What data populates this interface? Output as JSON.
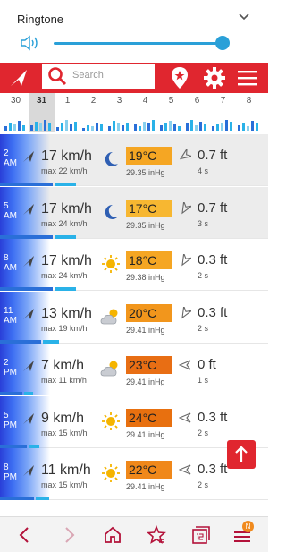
{
  "volume_panel": {
    "title": "Ringtone",
    "level": 0.97
  },
  "toolbar": {
    "search_placeholder": "Search"
  },
  "days": [
    {
      "num": "30",
      "selected": false
    },
    {
      "num": "31",
      "selected": true
    },
    {
      "num": "1",
      "selected": false
    },
    {
      "num": "2",
      "selected": false
    },
    {
      "num": "3",
      "selected": false
    },
    {
      "num": "4",
      "selected": false
    },
    {
      "num": "5",
      "selected": false
    },
    {
      "num": "6",
      "selected": false
    },
    {
      "num": "7",
      "selected": false
    },
    {
      "num": "8",
      "selected": false
    }
  ],
  "rows": [
    {
      "hour": "2",
      "ampm": "AM",
      "wind": "17 km/h",
      "max": "max 22 km/h",
      "weather": "moon",
      "temp": "19°C",
      "temp_color": "#f5a623",
      "pressure": "29.35 inHg",
      "swell": "0.7 ft",
      "period": "4 s",
      "wind_level": 0.31
    },
    {
      "hour": "5",
      "ampm": "AM",
      "wind": "17 km/h",
      "max": "max 24 km/h",
      "weather": "moon",
      "temp": "17°C",
      "temp_color": "#f7b731",
      "pressure": "29.35 inHg",
      "swell": "0.7 ft",
      "period": "3 s",
      "wind_level": 0.31
    },
    {
      "hour": "8",
      "ampm": "AM",
      "wind": "17 km/h",
      "max": "max 24 km/h",
      "weather": "sun",
      "temp": "18°C",
      "temp_color": "#f5a623",
      "pressure": "29.38 inHg",
      "swell": "0.3 ft",
      "period": "2 s",
      "wind_level": 0.31
    },
    {
      "hour": "11",
      "ampm": "AM",
      "wind": "13 km/h",
      "max": "max 19 km/h",
      "weather": "partly-cloudy",
      "temp": "20°C",
      "temp_color": "#f2961c",
      "pressure": "29.41 inHg",
      "swell": "0.3 ft",
      "period": "2 s",
      "wind_level": 0.24
    },
    {
      "hour": "2",
      "ampm": "PM",
      "wind": "7 km/h",
      "max": "max 11 km/h",
      "weather": "partly-cloudy",
      "temp": "23°C",
      "temp_color": "#e86e14",
      "pressure": "29.41 inHg",
      "swell": "0 ft",
      "period": "1 s",
      "wind_level": 0.13
    },
    {
      "hour": "5",
      "ampm": "PM",
      "wind": "9 km/h",
      "max": "max 15 km/h",
      "weather": "sun",
      "temp": "24°C",
      "temp_color": "#e8700f",
      "pressure": "29.41 inHg",
      "swell": "0.3 ft",
      "period": "2 s",
      "wind_level": 0.16
    },
    {
      "hour": "8",
      "ampm": "PM",
      "wind": "11 km/h",
      "max": "max 15 km/h",
      "weather": "sun",
      "temp": "22°C",
      "temp_color": "#f0881a",
      "pressure": "29.41 inHg",
      "swell": "0.3 ft",
      "period": "2 s",
      "wind_level": 0.2
    }
  ],
  "nav": {
    "badge": "N"
  },
  "colors": {
    "accent": "#e0262f",
    "link": "#2aa0d8"
  }
}
